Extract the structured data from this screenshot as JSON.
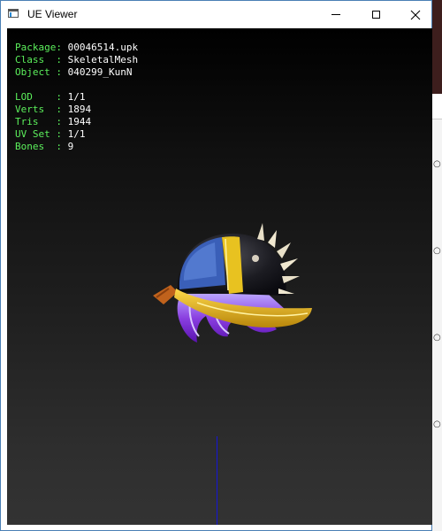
{
  "window": {
    "title": "UE Viewer",
    "controls": {
      "minimize": "minimize",
      "maximize": "maximize",
      "close": "close"
    }
  },
  "viewer_info": {
    "package_label": "Package:",
    "package": "00046514.upk",
    "class_label": "Class  :",
    "class": "SkeletalMesh",
    "object_label": "Object :",
    "object": "040299_KunN",
    "lod_label": "LOD    :",
    "lod": "1/1",
    "verts_label": "Verts  :",
    "verts": "1894",
    "tris_label": "Tris   :",
    "tris": "1944",
    "uvset_label": "UV Set :",
    "uvset": "1/1",
    "bones_label": "Bones  :",
    "bones": "9"
  },
  "colors": {
    "label_text": "#5cf05c",
    "value_text": "#ffffff",
    "axis_line": "#1515d8",
    "window_border": "#4a7fb5"
  },
  "icons": [
    "app-icon",
    "minimize-icon",
    "maximize-icon",
    "close-icon"
  ]
}
